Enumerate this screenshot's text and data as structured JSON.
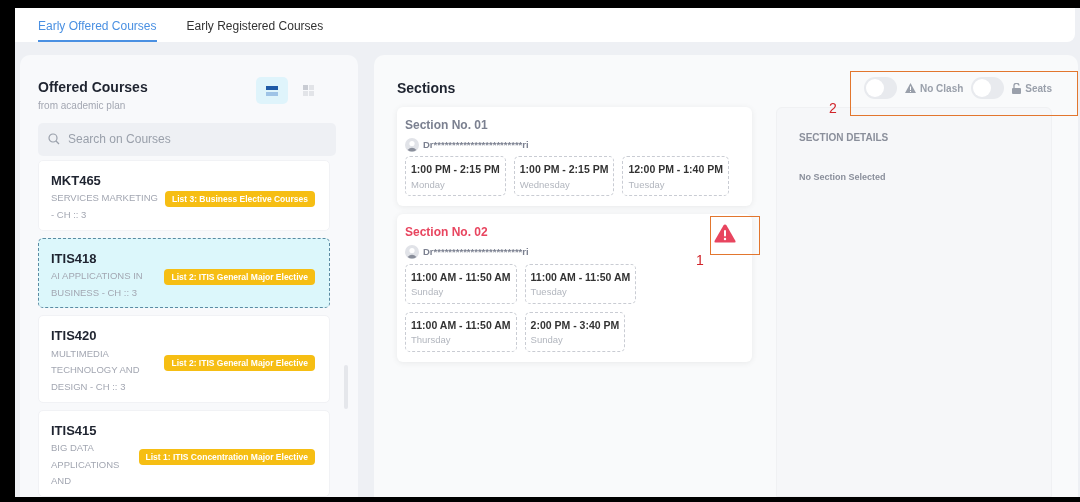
{
  "tabs": [
    {
      "label": "Early Offered Courses",
      "selected": true
    },
    {
      "label": "Early Registered Courses",
      "selected": false
    }
  ],
  "courses_panel": {
    "title": "Offered Courses",
    "subtitle": "from academic plan",
    "view_modes": [
      {
        "kind": "list",
        "selected": true
      },
      {
        "kind": "grid",
        "selected": false
      }
    ],
    "search": {
      "placeholder": "Search on Courses"
    },
    "courses": [
      {
        "code": "MKT465",
        "name": "SERVICES MARKETING - CH :: 3",
        "tag": "List 3: Business Elective Courses",
        "selected": false
      },
      {
        "code": "ITIS418",
        "name": "AI APPLICATIONS IN BUSINESS - CH :: 3",
        "tag": "List 2: ITIS General Major Elective",
        "selected": true
      },
      {
        "code": "ITIS420",
        "name": "MULTIMEDIA TECHNOLOGY AND DESIGN - CH :: 3",
        "tag": "List 2: ITIS General Major Elective",
        "selected": false
      },
      {
        "code": "ITIS415",
        "name": "BIG DATA APPLICATIONS AND",
        "tag": "List 1: ITIS Concentration Major Elective",
        "selected": false
      }
    ]
  },
  "sections_panel": {
    "title": "Sections",
    "toggles": [
      {
        "kind": "warning",
        "label": "No Clash",
        "on": false
      },
      {
        "kind": "lock",
        "label": "Seats",
        "on": false
      }
    ],
    "sections": [
      {
        "title": "Section No. 01",
        "clash": false,
        "instructor": "Dr************************ri",
        "times": [
          {
            "time": "1:00 PM - 2:15 PM",
            "day": "Monday"
          },
          {
            "time": "1:00 PM - 2:15 PM",
            "day": "Wednesday"
          },
          {
            "time": "12:00 PM - 1:40 PM",
            "day": "Tuesday"
          }
        ]
      },
      {
        "title": "Section No. 02",
        "clash": true,
        "instructor": "Dr************************ri",
        "times": [
          {
            "time": "11:00 AM - 11:50 AM",
            "day": "Sunday"
          },
          {
            "time": "11:00 AM - 11:50 AM",
            "day": "Tuesday"
          },
          {
            "time": "11:00 AM - 11:50 AM",
            "day": "Thursday"
          },
          {
            "time": "2:00 PM - 3:40 PM",
            "day": "Sunday"
          }
        ]
      }
    ],
    "details": {
      "title": "SECTION DETAILS",
      "message": "No Section Selected"
    }
  },
  "annotations": [
    {
      "label": "1"
    },
    {
      "label": "2"
    }
  ]
}
